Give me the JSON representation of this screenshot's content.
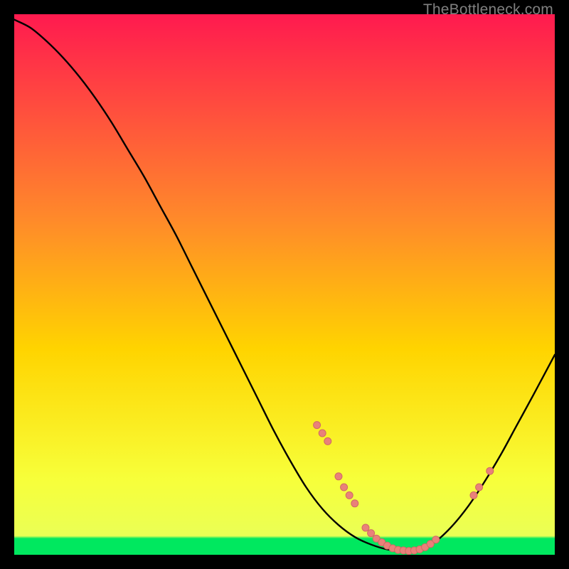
{
  "attribution": "TheBottleneck.com",
  "colors": {
    "frame": "#000000",
    "curve": "#000000",
    "dot_fill": "#e9817a",
    "dot_stroke": "#cf6b64",
    "gradient_top": "#ff1a4f",
    "gradient_mid_upper": "#ff7a2e",
    "gradient_mid": "#ffd400",
    "gradient_mid_lower": "#f7ff3a",
    "gradient_floor": "#00e85f"
  },
  "chart_data": {
    "type": "line",
    "title": "",
    "xlabel": "",
    "ylabel": "",
    "xlim": [
      0,
      100
    ],
    "ylim": [
      0,
      100
    ],
    "x": [
      0,
      3,
      6,
      9,
      12,
      15,
      18,
      21,
      24,
      27,
      30,
      33,
      36,
      39,
      42,
      45,
      48,
      51,
      54,
      57,
      60,
      63,
      66,
      69,
      72,
      75,
      78,
      81,
      84,
      87,
      90,
      93,
      96,
      100
    ],
    "values": [
      99,
      97.5,
      95,
      92,
      88.5,
      84.5,
      80,
      75,
      70,
      64.5,
      59,
      53,
      47,
      41,
      35,
      29,
      23,
      17.5,
      12.5,
      8.5,
      5.5,
      3.3,
      1.9,
      1.0,
      0.7,
      1.0,
      2.5,
      5.3,
      9.0,
      13.5,
      18.5,
      24.0,
      29.5,
      37.0
    ],
    "highlight_points": [
      {
        "x": 56,
        "y": 24.0
      },
      {
        "x": 57,
        "y": 22.5
      },
      {
        "x": 58,
        "y": 21.0
      },
      {
        "x": 60,
        "y": 14.5
      },
      {
        "x": 61,
        "y": 12.5
      },
      {
        "x": 62,
        "y": 11.0
      },
      {
        "x": 63,
        "y": 9.5
      },
      {
        "x": 65,
        "y": 5.0
      },
      {
        "x": 66,
        "y": 4.0
      },
      {
        "x": 67,
        "y": 3.0
      },
      {
        "x": 68,
        "y": 2.3
      },
      {
        "x": 69,
        "y": 1.7
      },
      {
        "x": 70,
        "y": 1.2
      },
      {
        "x": 71,
        "y": 0.9
      },
      {
        "x": 72,
        "y": 0.8
      },
      {
        "x": 73,
        "y": 0.7
      },
      {
        "x": 74,
        "y": 0.8
      },
      {
        "x": 75,
        "y": 1.0
      },
      {
        "x": 76,
        "y": 1.4
      },
      {
        "x": 77,
        "y": 2.0
      },
      {
        "x": 78,
        "y": 2.8
      },
      {
        "x": 85,
        "y": 11.0
      },
      {
        "x": 86,
        "y": 12.5
      },
      {
        "x": 88,
        "y": 15.5
      }
    ],
    "dot_radius": 5,
    "smoothing": true
  }
}
